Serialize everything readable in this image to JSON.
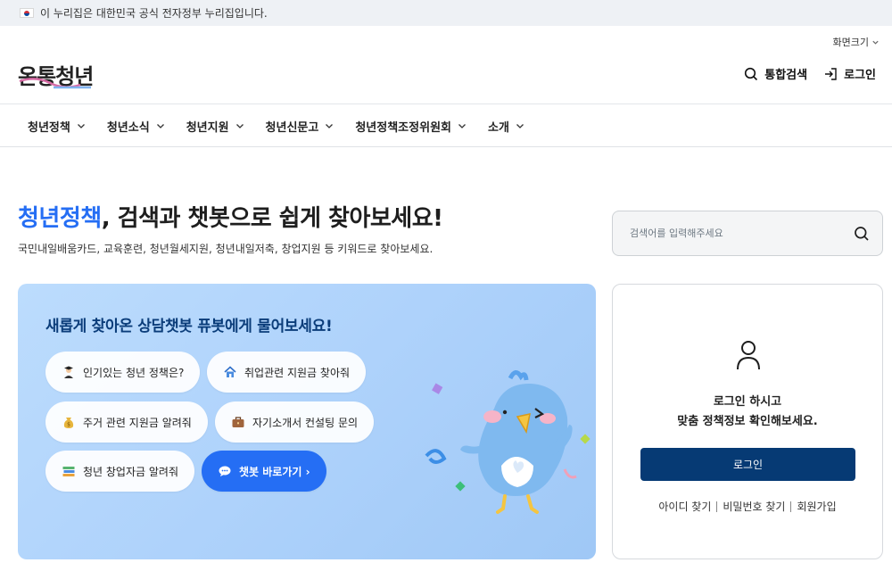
{
  "gov_banner": {
    "text": "이 누리집은 대한민국 공식 전자정부 누리집입니다."
  },
  "header": {
    "screen_size_label": "화면크기",
    "logo_text": "온통청년",
    "search_label": "통합검색",
    "login_label": "로그인"
  },
  "nav": {
    "items": [
      {
        "label": "청년정책"
      },
      {
        "label": "청년소식"
      },
      {
        "label": "청년지원"
      },
      {
        "label": "청년신문고"
      },
      {
        "label": "청년정책조정위원회"
      },
      {
        "label": "소개"
      }
    ]
  },
  "hero": {
    "title_accent": "청년정책",
    "title_rest": ", 검색과 챗봇으로 쉽게 찾아보세요!",
    "subtitle": "국민내일배움카드, 교육훈련, 청년월세지원, 청년내일저축, 창업지원 등 키워드로 찾아보세요.",
    "search_placeholder": "검색어를 입력해주세요"
  },
  "chatbot": {
    "title_pre": "새롭게 찾아온 상담챗봇 ",
    "title_name": "퓨봇",
    "title_post": "에게 물어보세요!",
    "chips": [
      {
        "label": "인기있는 청년 정책은?",
        "icon": "graduate-icon"
      },
      {
        "label": "취업관련 지원금 찾아줘",
        "icon": "house-icon"
      },
      {
        "label": "주거 관련 지원금 알려줘",
        "icon": "money-bag-icon"
      },
      {
        "label": "자기소개서 컨설팅 문의",
        "icon": "briefcase-icon"
      },
      {
        "label": "청년 창업자금 알려줘",
        "icon": "books-icon"
      }
    ],
    "cta_label": "챗봇 바로가기 ›"
  },
  "login_card": {
    "message_line1": "로그인 하시고",
    "message_line2": "맞춤 정책정보 확인해보세요.",
    "login_button": "로그인",
    "links": [
      {
        "label": "아이디 찾기"
      },
      {
        "label": "비밀번호 찾기"
      },
      {
        "label": "회원가입"
      }
    ]
  },
  "colors": {
    "accent": "#256ef4",
    "navy": "#063a74",
    "chat_bg": "#aed2fb"
  }
}
